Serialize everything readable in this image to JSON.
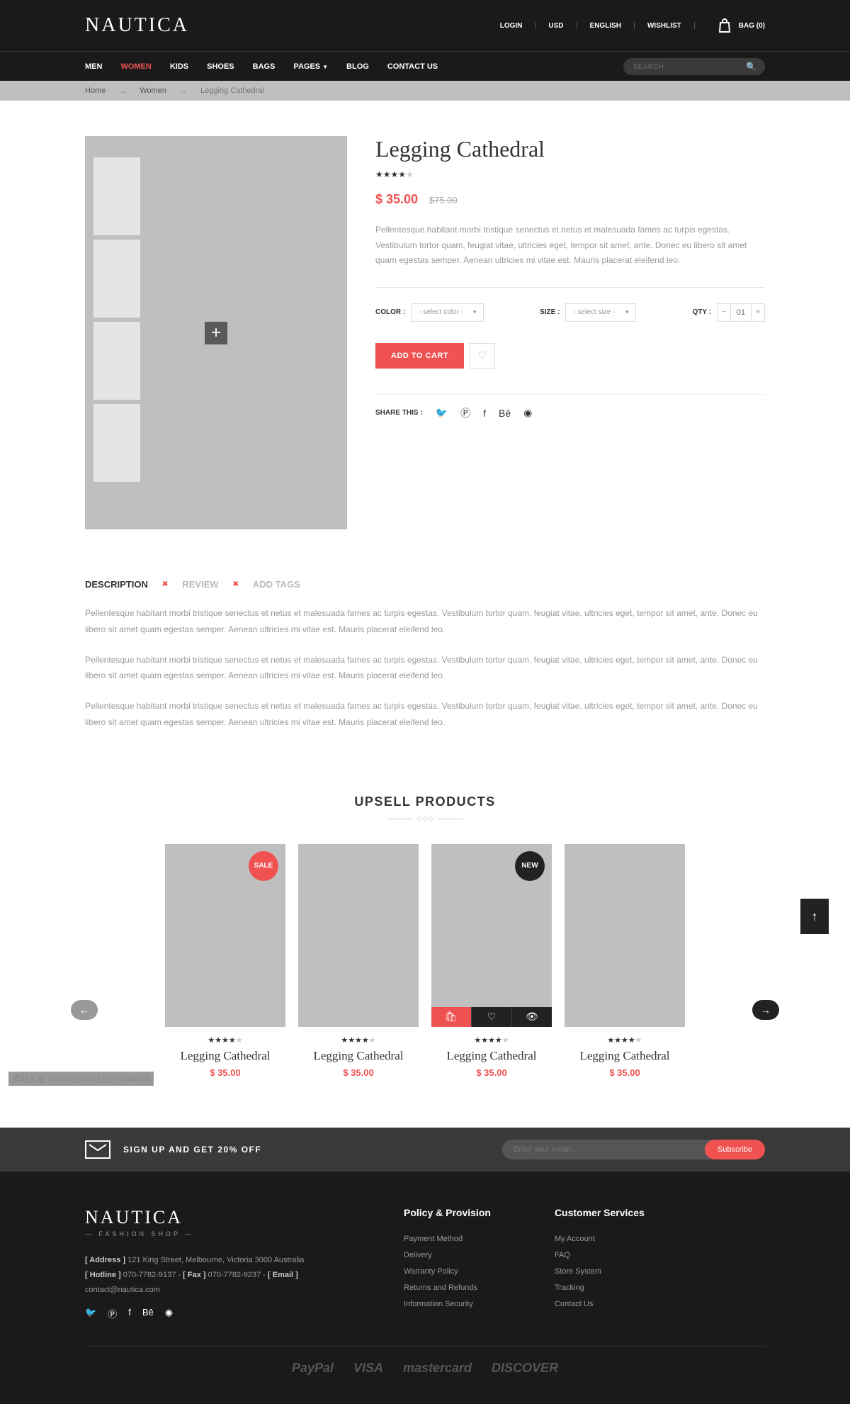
{
  "brand": "NAUTICA",
  "topLinks": {
    "login": "LOGIN",
    "currency": "USD",
    "language": "ENGLISH",
    "wishlist": "WISHLIST",
    "bag": "BAG (0)"
  },
  "nav": {
    "men": "MEN",
    "women": "WOMEN",
    "kids": "KIDS",
    "shoes": "SHOES",
    "bags": "BAGS",
    "pages": "PAGES",
    "blog": "BLOG",
    "contact": "CONTACT US"
  },
  "search": {
    "placeholder": "SEARCH"
  },
  "breadcrumb": {
    "home": "Home",
    "women": "Women",
    "current": "Legging Cathedral"
  },
  "product": {
    "title": "Legging Cathedral",
    "rating": 4,
    "priceNow": "$ 35.00",
    "priceOld": "$75.00",
    "desc": "Pellentesque habitant morbi tristique senectus et netus et malesuada fames ac turpis egestas. Vestibulum tortor quam, feugiat vitae, ultricies eget, tempor sit amet, ante. Donec eu libero sit amet quam egestas semper. Aenean ultricies mi vitae est. Mauris placerat eleifend leo.",
    "colorLabel": "COLOR :",
    "colorPlaceholder": "- select color -",
    "sizeLabel": "SIZE :",
    "sizePlaceholder": "- select size -",
    "qtyLabel": "QTY :",
    "qtyValue": "01",
    "addToCart": "ADD TO CART",
    "shareLabel": "SHARE THIS :"
  },
  "tabs": {
    "description": "DESCRIPTION",
    "review": "REVIEW",
    "addTags": "ADD TAGS"
  },
  "tabContent": {
    "p1": "Pellentesque habitant morbi tristique senectus et netus et malesuada fames ac turpis egestas. Vestibulum tortor quam, feugiat vitae, ultricies eget, tempor sit amet, ante. Donec eu libero sit amet quam egestas semper. Aenean ultricies mi vitae est. Mauris placerat eleifend leo.",
    "p2": "Pellentesque habitant morbi tristique senectus et netus et malesuada fames ac turpis egestas. Vestibulum tortor quam, feugiat vitae, ultricies eget, tempor sit amet, ante. Donec eu libero sit amet quam egestas semper. Aenean ultricies mi vitae est. Mauris placerat eleifend leo.",
    "p3": "Pellentesque habitant morbi tristique senectus et netus et malesuada fames ac turpis egestas. Vestibulum tortor quam, feugiat vitae, ultricies eget, tempor sit amet, ante. Donec eu libero sit amet quam egestas semper. Aenean ultricies mi vitae est. Mauris placerat eleifend leo."
  },
  "upsell": {
    "title": "UPSELL PRODUCTS",
    "items": [
      {
        "name": "Legging Cathedral",
        "price": "$ 35.00",
        "badge": "SALE",
        "badgeType": "sale",
        "showActions": false
      },
      {
        "name": "Legging Cathedral",
        "price": "$ 35.00",
        "badge": "",
        "badgeType": "",
        "showActions": false
      },
      {
        "name": "Legging Cathedral",
        "price": "$ 35.00",
        "badge": "NEW",
        "badgeType": "new",
        "showActions": true
      },
      {
        "name": "Legging Cathedral",
        "price": "$ 35.00",
        "badge": "",
        "badgeType": "",
        "showActions": false
      }
    ]
  },
  "newsletter": {
    "text": "SIGN UP AND GET 20% OFF",
    "placeholder": "Enter your email...",
    "button": "Subscribe"
  },
  "footer": {
    "brand": "NAUTICA",
    "sub": "— FASHION SHOP —",
    "addressLabel": "[ Address ]",
    "address": "  121 King Street, Melbourne,  Victoria 3000 Australia",
    "hotlineLabel": "[ Hotline ]",
    "hotline": "  070-7782-9137  -  ",
    "faxLabel": "[ Fax ]",
    "fax": "  070-7782-9237  -  ",
    "emailLabel": "[ Email ]",
    "email": "  contact@nautica.com",
    "col1": {
      "head": "Policy & Provision",
      "links": [
        "Payment Method",
        "Delivery",
        "Warranty Policy",
        "Returns and Refunds",
        "Information Security"
      ]
    },
    "col2": {
      "head": "Customer Services",
      "links": [
        "My Account",
        "FAQ",
        "Store System",
        "Tracking",
        "Contact Us"
      ]
    },
    "payments": [
      "PayPal",
      "VISA",
      "mastercard",
      "DISCOVER"
    ]
  },
  "watermark": "素材来源: sucai999.com | ID: 04088458"
}
